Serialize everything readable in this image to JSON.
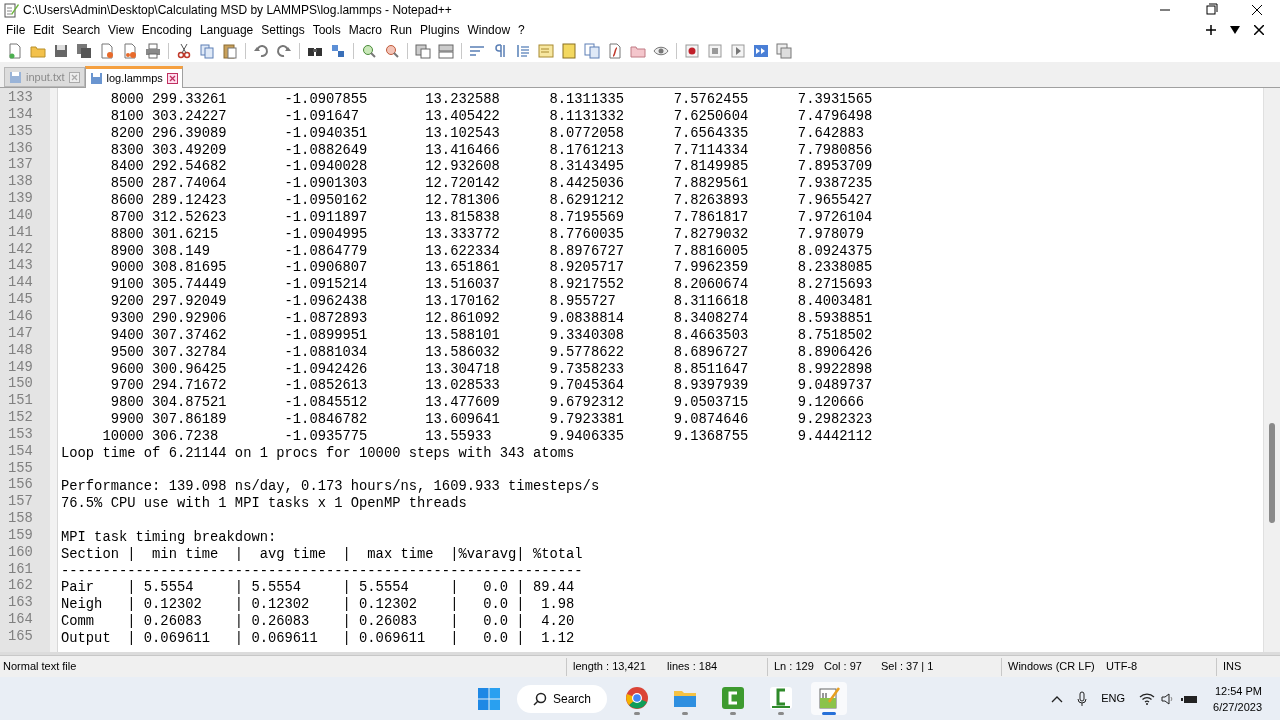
{
  "window": {
    "title": "C:\\Users\\Admin\\Desktop\\Calculating MSD by LAMMPS\\log.lammps - Notepad++"
  },
  "menu": [
    "File",
    "Edit",
    "Search",
    "View",
    "Encoding",
    "Language",
    "Settings",
    "Tools",
    "Macro",
    "Run",
    "Plugins",
    "Window",
    "?"
  ],
  "tabs": [
    {
      "label": "input.txt",
      "selected": false
    },
    {
      "label": "log.lammps",
      "selected": true
    }
  ],
  "editor": {
    "lines": [
      {
        "number": "133",
        "kind": "thermo",
        "values": [
          "8000",
          "299.33261",
          "-1.0907855",
          "13.232588",
          "8.1311335",
          "7.5762455",
          "7.3931565"
        ]
      },
      {
        "number": "134",
        "kind": "thermo",
        "values": [
          "8100",
          "303.24227",
          "-1.091647",
          "13.405422",
          "8.1131332",
          "7.6250604",
          "7.4796498"
        ]
      },
      {
        "number": "135",
        "kind": "thermo",
        "values": [
          "8200",
          "296.39089",
          "-1.0940351",
          "13.102543",
          "8.0772058",
          "7.6564335",
          "7.642883"
        ]
      },
      {
        "number": "136",
        "kind": "thermo",
        "values": [
          "8300",
          "303.49209",
          "-1.0882649",
          "13.416466",
          "8.1761213",
          "7.7114334",
          "7.7980856"
        ]
      },
      {
        "number": "137",
        "kind": "thermo",
        "values": [
          "8400",
          "292.54682",
          "-1.0940028",
          "12.932608",
          "8.3143495",
          "7.8149985",
          "7.8953709"
        ]
      },
      {
        "number": "138",
        "kind": "thermo",
        "values": [
          "8500",
          "287.74064",
          "-1.0901303",
          "12.720142",
          "8.4425036",
          "7.8829561",
          "7.9387235"
        ]
      },
      {
        "number": "139",
        "kind": "thermo",
        "values": [
          "8600",
          "289.12423",
          "-1.0950162",
          "12.781306",
          "8.6291212",
          "7.8263893",
          "7.9655427"
        ]
      },
      {
        "number": "140",
        "kind": "thermo",
        "values": [
          "8700",
          "312.52623",
          "-1.0911897",
          "13.815838",
          "8.7195569",
          "7.7861817",
          "7.9726104"
        ]
      },
      {
        "number": "141",
        "kind": "thermo",
        "values": [
          "8800",
          "301.6215",
          "-1.0904995",
          "13.333772",
          "8.7760035",
          "7.8279032",
          "7.978079"
        ]
      },
      {
        "number": "142",
        "kind": "thermo",
        "values": [
          "8900",
          "308.149",
          "-1.0864779",
          "13.622334",
          "8.8976727",
          "7.8816005",
          "8.0924375"
        ]
      },
      {
        "number": "143",
        "kind": "thermo",
        "values": [
          "9000",
          "308.81695",
          "-1.0906807",
          "13.651861",
          "8.9205717",
          "7.9962359",
          "8.2338085"
        ]
      },
      {
        "number": "144",
        "kind": "thermo",
        "values": [
          "9100",
          "305.74449",
          "-1.0915214",
          "13.516037",
          "8.9217552",
          "8.2060674",
          "8.2715693"
        ]
      },
      {
        "number": "145",
        "kind": "thermo",
        "values": [
          "9200",
          "297.92049",
          "-1.0962438",
          "13.170162",
          "8.955727",
          "8.3116618",
          "8.4003481"
        ]
      },
      {
        "number": "146",
        "kind": "thermo",
        "values": [
          "9300",
          "290.92906",
          "-1.0872893",
          "12.861092",
          "9.0838814",
          "8.3408274",
          "8.5938851"
        ]
      },
      {
        "number": "147",
        "kind": "thermo",
        "values": [
          "9400",
          "307.37462",
          "-1.0899951",
          "13.588101",
          "9.3340308",
          "8.4663503",
          "8.7518502"
        ]
      },
      {
        "number": "148",
        "kind": "thermo",
        "values": [
          "9500",
          "307.32784",
          "-1.0881034",
          "13.586032",
          "9.5778622",
          "8.6896727",
          "8.8906426"
        ]
      },
      {
        "number": "149",
        "kind": "thermo",
        "values": [
          "9600",
          "300.96425",
          "-1.0942426",
          "13.304718",
          "9.7358233",
          "8.8511647",
          "8.9922898"
        ]
      },
      {
        "number": "150",
        "kind": "thermo",
        "values": [
          "9700",
          "294.71672",
          "-1.0852613",
          "13.028533",
          "9.7045364",
          "8.9397939",
          "9.0489737"
        ]
      },
      {
        "number": "151",
        "kind": "thermo",
        "values": [
          "9800",
          "304.87521",
          "-1.0845512",
          "13.477609",
          "9.6792312",
          "9.0503715",
          "9.120666"
        ]
      },
      {
        "number": "152",
        "kind": "thermo",
        "values": [
          "9900",
          "307.86189",
          "-1.0846782",
          "13.609641",
          "9.7923381",
          "9.0874646",
          "9.2982323"
        ]
      },
      {
        "number": "153",
        "kind": "thermo",
        "values": [
          "10000",
          "306.7238",
          "-1.0935775",
          "13.55933",
          "9.9406335",
          "9.1368755",
          "9.4442112"
        ]
      },
      {
        "number": "154",
        "kind": "text",
        "text": "Loop time of 6.21144 on 1 procs for 10000 steps with 343 atoms"
      },
      {
        "number": "155",
        "kind": "blank"
      },
      {
        "number": "156",
        "kind": "text",
        "text": "Performance: 139.098 ns/day, 0.173 hours/ns, 1609.933 timesteps/s"
      },
      {
        "number": "157",
        "kind": "text",
        "text": "76.5% CPU use with 1 MPI tasks x 1 OpenMP threads"
      },
      {
        "number": "158",
        "kind": "blank"
      },
      {
        "number": "159",
        "kind": "text",
        "text": "MPI task timing breakdown:"
      },
      {
        "number": "160",
        "kind": "text",
        "text": "Section |  min time  |  avg time  |  max time  |%varavg| %total"
      },
      {
        "number": "161",
        "kind": "text",
        "text": "---------------------------------------------------------------"
      },
      {
        "number": "162",
        "kind": "text",
        "text": "Pair    | 5.5554     | 5.5554     | 5.5554     |   0.0 | 89.44"
      },
      {
        "number": "163",
        "kind": "text",
        "text": "Neigh   | 0.12302    | 0.12302    | 0.12302    |   0.0 |  1.98"
      },
      {
        "number": "164",
        "kind": "text",
        "text": "Comm    | 0.26083    | 0.26083    | 0.26083    |   0.0 |  4.20"
      },
      {
        "number": "165",
        "kind": "text",
        "text": "Output  | 0.069611   | 0.069611   | 0.069611   |   0.0 |  1.12"
      }
    ]
  },
  "status_bar": {
    "file_type": "Normal text file",
    "length": "length : 13,421",
    "lines": "lines : 184",
    "ln": "Ln : 129",
    "col": "Col : 97",
    "sel": "Sel : 37 | 1",
    "eol": "Windows (CR LF)",
    "encoding": "UTF-8",
    "mode": "INS"
  },
  "taskbar": {
    "search": "Search",
    "time": "12:54 PM",
    "date": "6/27/2023",
    "language": "ENG"
  }
}
